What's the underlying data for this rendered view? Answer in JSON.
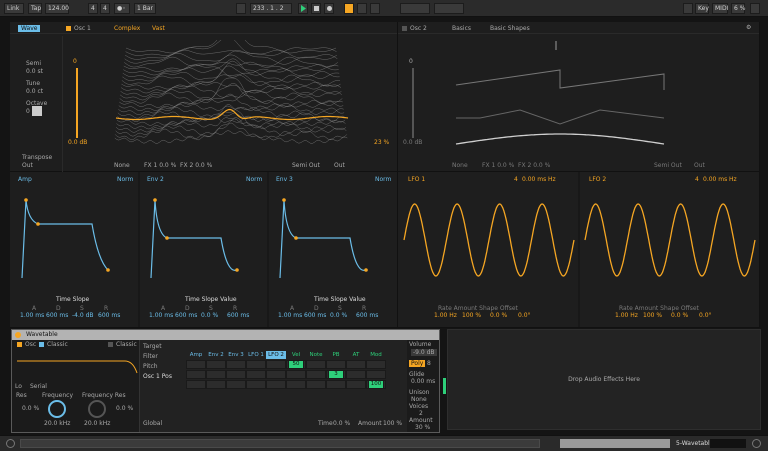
{
  "transport": {
    "link": "Link",
    "tap": "Tap",
    "tempo": "124.00",
    "sig_num": "4",
    "sig_den": "4",
    "metro": "1 Bar",
    "position": "233 . 1 . 2",
    "key": "Key",
    "midi": "MIDI",
    "cpu": "6 %"
  },
  "osc1": {
    "name": "Osc 1",
    "category": "Complex",
    "wavetable": "Vast",
    "mode_tab": "Wave",
    "semi_label": "Semi",
    "semi_val": "0.0 st",
    "tune_label": "Tune",
    "tune_val": "0.0 ct",
    "octave_label": "Octave",
    "octave_val": "0",
    "transpose_label": "Transpose",
    "transpose_val": "Out",
    "gain_top": "0",
    "gain_val": "0.0 dB",
    "pos_val": "23 %",
    "fx_mode": "None",
    "fx1": "FX 1 0.0 %",
    "fx2": "FX 2 0.0 %",
    "semi_out": "Semi Out",
    "out_label": "Out",
    "out_val": "Out"
  },
  "osc2": {
    "name": "Osc 2",
    "category": "Basics",
    "wavetable": "Basic Shapes",
    "gain_top": "0",
    "gain_val": "0.0 dB",
    "fx_mode": "None",
    "fx1": "FX 1 0.0 %",
    "fx2": "FX 2 0.0 %",
    "semi_out": "Semi Out",
    "out_val": "Out"
  },
  "envs": [
    {
      "name": "Amp",
      "mode": "Norm",
      "slope": "Time Slope",
      "vals": [
        "1.00 ms",
        "600 ms",
        "-4.0 dB",
        "600 ms"
      ]
    },
    {
      "name": "Env 2",
      "mode": "Norm",
      "slope": "Time Slope Value",
      "vals": [
        "1.00 ms",
        "600 ms",
        "0.0 %",
        "600 ms"
      ]
    },
    {
      "name": "Env 3",
      "mode": "Norm",
      "slope": "Time Slope Value",
      "vals": [
        "1.00 ms",
        "600 ms",
        "0.0 %",
        "600 ms"
      ]
    }
  ],
  "env_params": [
    "A",
    "D",
    "S",
    "R"
  ],
  "lfos": [
    {
      "name": "LFO 1",
      "rate": "4",
      "unit": "Hz",
      "foot": "Rate Amount Shape Offset",
      "vals": [
        "1.00 Hz",
        "100 %",
        "0.0 %",
        "0.0°"
      ],
      "time": "0.00 ms"
    },
    {
      "name": "LFO 2",
      "rate": "4",
      "unit": "Hz",
      "foot": "Rate Amount Shape Offset",
      "vals": [
        "1.00 Hz",
        "100 %",
        "0.0 %",
        "0.0°"
      ],
      "time": "0.00 ms"
    }
  ],
  "device": {
    "title": "Wavetable",
    "osc_label": "Osc",
    "classic_label": "Classic",
    "classic2_label": "Classic",
    "filter_type": "Lo",
    "filter_mode": "Serial",
    "res_label": "Res",
    "res_val": "0.0 %",
    "freq_label": "Frequency",
    "freq_val": "20.0 kHz",
    "freqres_label": "Frequency Res",
    "freqres_val": "0.0 %",
    "freq2_val": "20.0 kHz",
    "global_label": "Global",
    "time_label": "Time",
    "time_val": "0.0 %",
    "amount_label": "Amount",
    "amount_val": "100 %",
    "matrix_rows": [
      "Target",
      "Filter",
      "Pitch",
      "Osc 1 Pos"
    ],
    "matrix_cols": [
      "Amp",
      "Env 2",
      "Env 3",
      "LFO 1",
      "LFO 2",
      "Vel",
      "Note",
      "PB",
      "AT",
      "Mod"
    ],
    "matrix_values": [
      {
        "row": 1,
        "col": 5,
        "value": "50"
      },
      {
        "row": 2,
        "col": 7,
        "value": "3"
      },
      {
        "row": 3,
        "col": 9,
        "value": "100"
      }
    ],
    "volume_label": "Volume",
    "volume_val": "-9.0 dB",
    "poly_label": "Poly",
    "poly_val": "8",
    "glide_label": "Glide",
    "glide_val": "0.00 ms",
    "unison_label": "Unison",
    "unison_val": "None",
    "voices_label": "Voices",
    "voices_val": "2",
    "amount2_label": "Amount",
    "amount2_val": "30 %"
  },
  "drop_text": "Drop Audio Effects Here",
  "status": {
    "track": "5-Wavetable"
  },
  "colors": {
    "accent": "#f5a623",
    "env": "#6bbde8",
    "matrix_hi": "#2ed07a"
  }
}
